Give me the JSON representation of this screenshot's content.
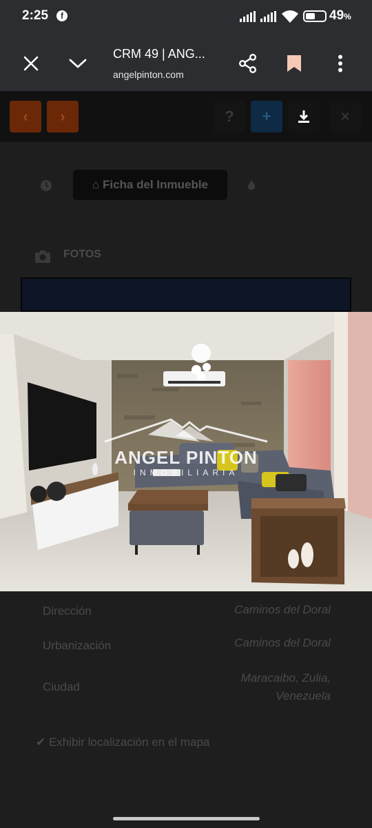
{
  "status_bar": {
    "time": "2:25",
    "battery_pct": "49",
    "battery_unit": "%",
    "battery_level": 0.49
  },
  "toolbar": {
    "title": "CRM 49 | ANG...",
    "url": "angelpinton.com"
  },
  "page": {
    "ficha_label": "Ficha del Inmueble",
    "fotos_label": "FOTOS",
    "fields": [
      {
        "label": "Dirección",
        "value": "Caminos del Doral"
      },
      {
        "label": "Urbanización",
        "value": "Caminos del Doral"
      },
      {
        "label": "Ciudad",
        "value": "Maracaibo, Zulia, Venezuela"
      }
    ],
    "exhibit_label": "Exhibir localización en el mapa"
  },
  "photo": {
    "watermark_name": "ANGEL PINTON",
    "watermark_sub": "INMOBILIARIA"
  },
  "colors": {
    "toolbar_bg": "#2b2d31",
    "bookmark": "#f5c9b5",
    "orange_btn": "#7a2e06",
    "blue_btn": "#0e2a44"
  }
}
